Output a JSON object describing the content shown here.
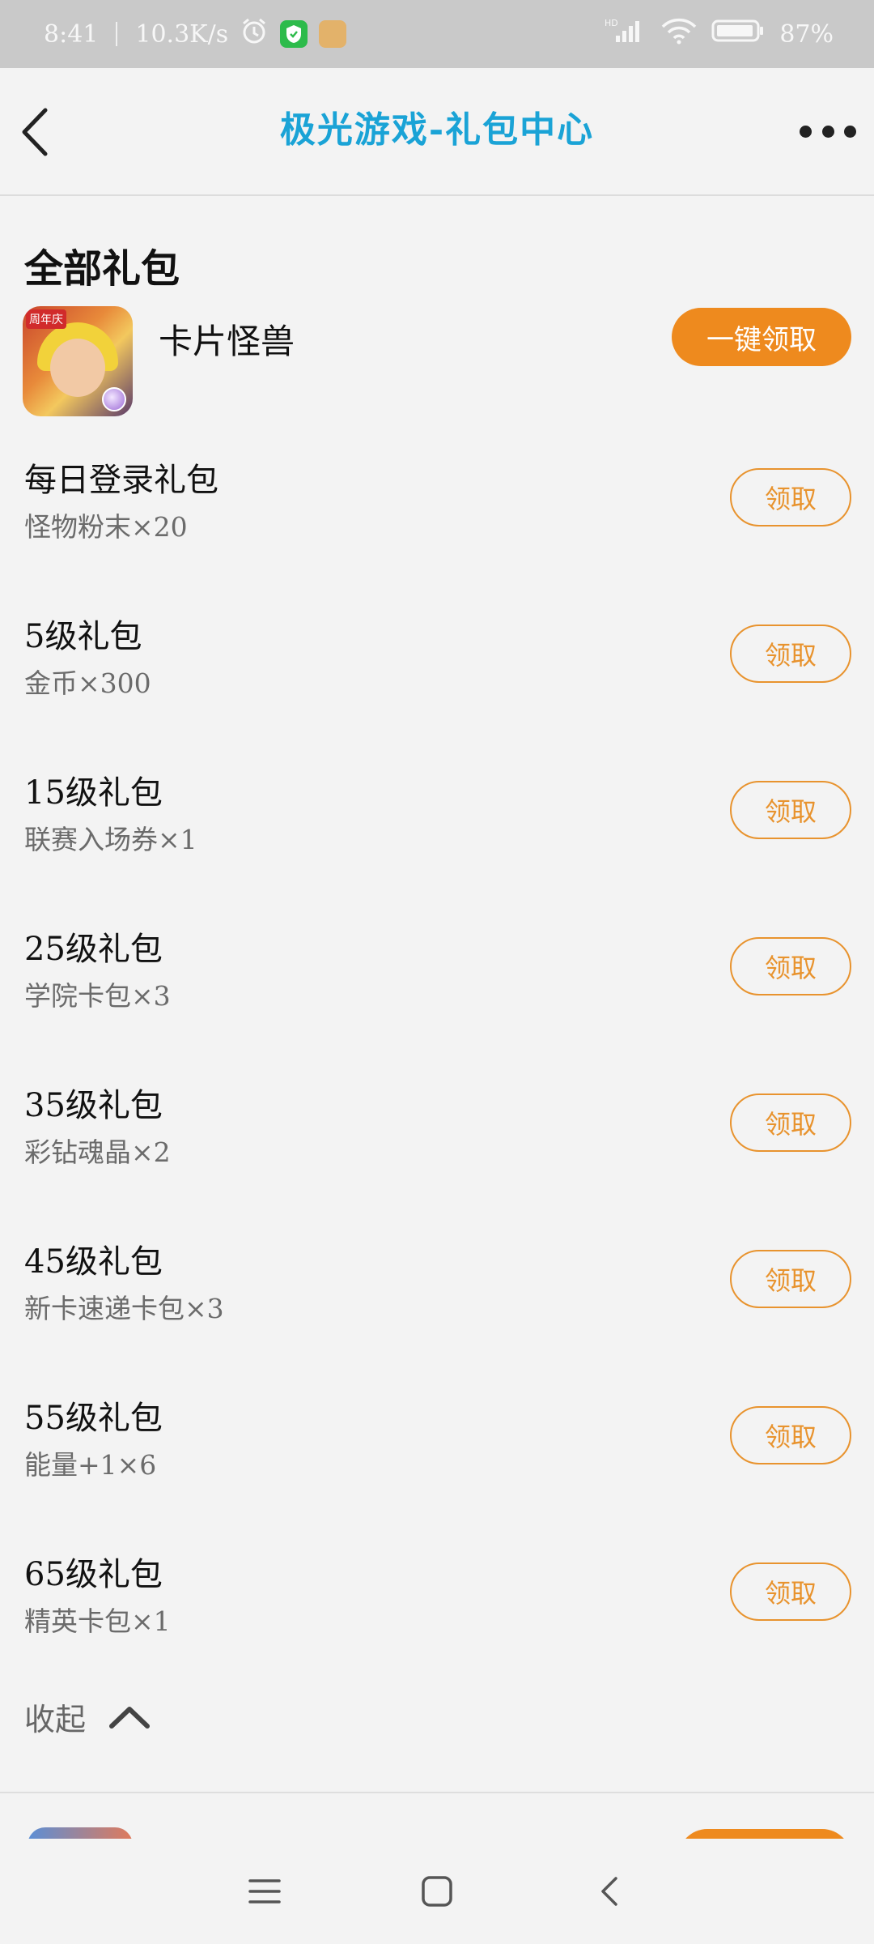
{
  "status_bar": {
    "time": "8:41",
    "net_speed": "10.3K/s",
    "battery": "87%",
    "icons": [
      "alarm-icon",
      "shield-app-icon",
      "game-app-icon",
      "hd-signal-icon",
      "wifi-icon",
      "battery-icon"
    ]
  },
  "header": {
    "title": "极光游戏-礼包中心",
    "back_icon": "chevron-left-icon",
    "more_icon": "more-dots-icon"
  },
  "section": {
    "title": "全部礼包"
  },
  "game": {
    "name": "卡片怪兽",
    "icon_badge": "周年庆",
    "claim_all_label": "一键领取"
  },
  "gifts": [
    {
      "name": "每日登录礼包",
      "desc": "怪物粉末×20",
      "action": "领取"
    },
    {
      "name": "5级礼包",
      "desc": "金币×300",
      "action": "领取"
    },
    {
      "name": "15级礼包",
      "desc": "联赛入场券×1",
      "action": "领取"
    },
    {
      "name": "25级礼包",
      "desc": "学院卡包×3",
      "action": "领取"
    },
    {
      "name": "35级礼包",
      "desc": "彩钻魂晶×2",
      "action": "领取"
    },
    {
      "name": "45级礼包",
      "desc": "新卡速递卡包×3",
      "action": "领取"
    },
    {
      "name": "55级礼包",
      "desc": "能量+1×6",
      "action": "领取"
    },
    {
      "name": "65级礼包",
      "desc": "精英卡包×1",
      "action": "领取"
    }
  ],
  "collapse": {
    "label": "收起",
    "icon": "chevron-up-icon"
  },
  "nav": {
    "icons": [
      "menu-icon",
      "home-icon",
      "back-icon"
    ]
  },
  "colors": {
    "accent_orange": "#ee8a1e",
    "title_blue": "#1aa3d6",
    "status_bar": "#c9c9c9"
  }
}
